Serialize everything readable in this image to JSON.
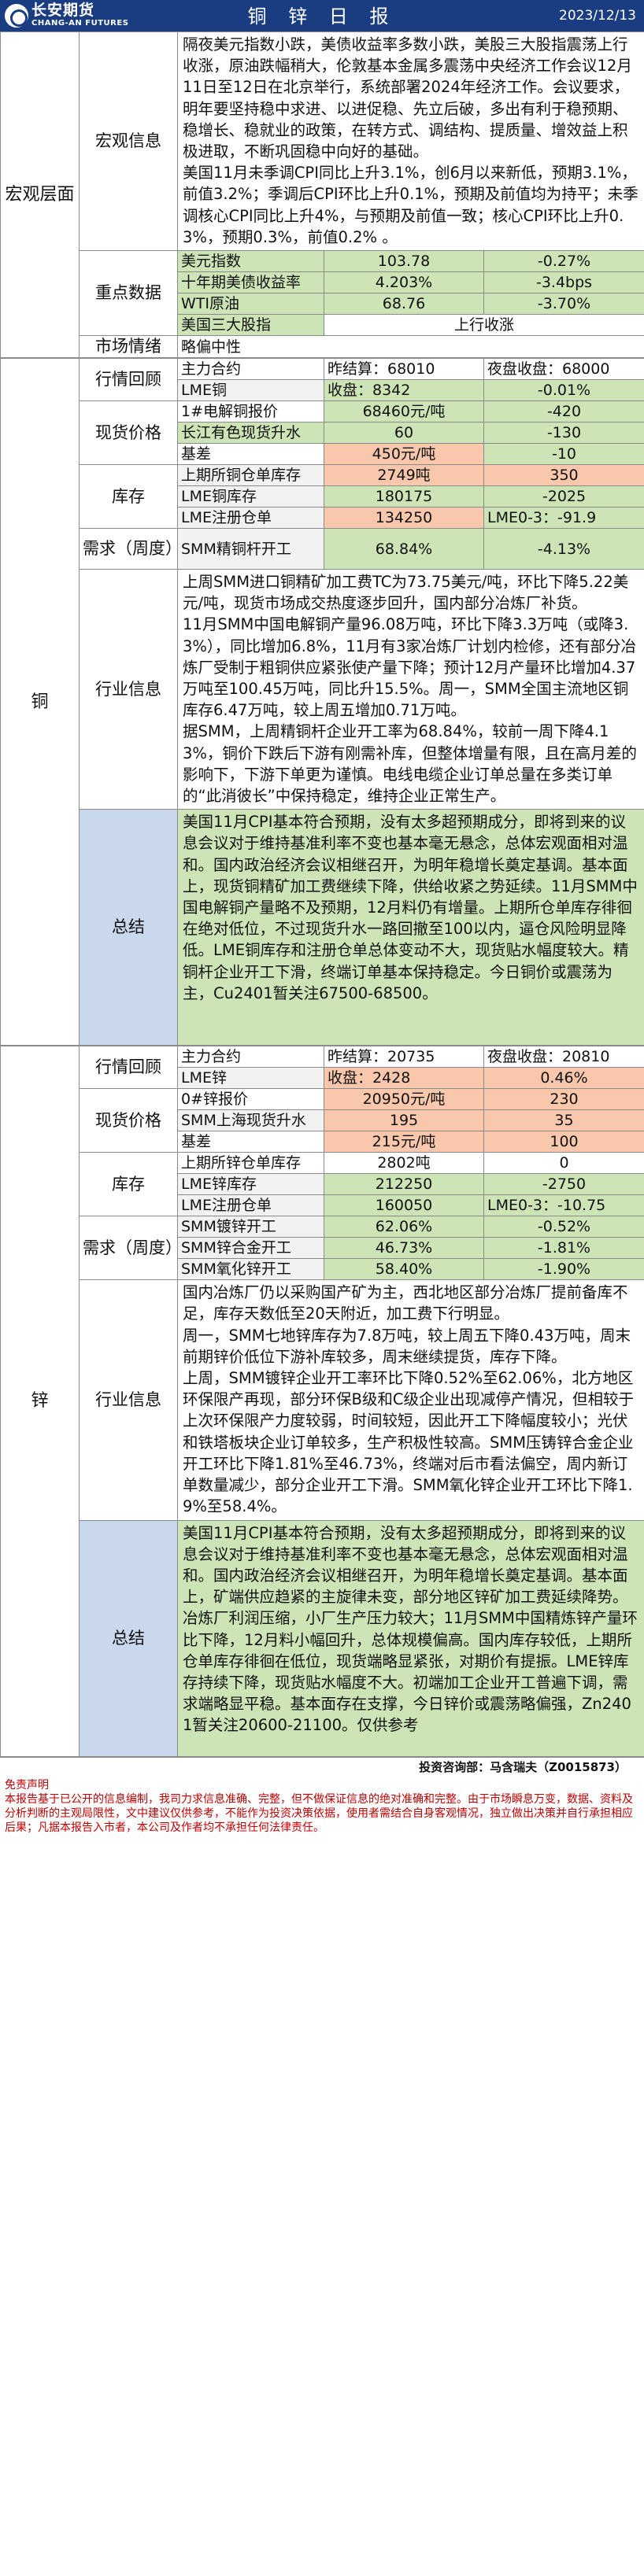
{
  "header": {
    "brand_cn": "长安期货",
    "brand_en": "CHANG-AN FUTURES",
    "title": "铜 锌 日 报",
    "date": "2023/12/13"
  },
  "macro": {
    "section": "宏观层面",
    "info_label": "宏观信息",
    "info_text": "隔夜美元指数小跌，美债收益率多数小跌，美股三大股指震荡上行收涨，原油跌幅稍大，伦敦基本金属多震荡中央经济工作会议12月11日至12日在北京举行，系统部署2024年经济工作。会议要求，明年要坚持稳中求进、以进促稳、先立后破，多出有利于稳预期、稳增长、稳就业的政策，在转方式、调结构、提质量、增效益上积极进取，不断巩固稳中向好的基础。\n美国11月未季调CPI同比上升3.1%，创6月以来新低，预期3.1%，前值3.2%；季调后CPI环比上升0.1%，预期及前值均为持平；未季调核心CPI同比上升4%，与预期及前值一致；核心CPI环比上升0.3%，预期0.3%，前值0.2% 。",
    "key_label": "重点数据",
    "key_rows": [
      {
        "name": "美元指数",
        "value": "103.78",
        "change": "-0.27%"
      },
      {
        "name": "十年期美债收益率",
        "value": "4.203%",
        "change": "-3.4bps"
      },
      {
        "name": "WTI原油",
        "value": "68.76",
        "change": "-3.70%"
      },
      {
        "name": "美国三大股指",
        "merged": "上行收涨"
      }
    ],
    "sentiment_label": "市场情绪",
    "sentiment_value": "略偏中性"
  },
  "copper": {
    "section": "铜",
    "review_label": "行情回顾",
    "review_head": {
      "name": "主力合约",
      "settle": "昨结算：68010",
      "night": "夜盘收盘：68000"
    },
    "review_row": {
      "name": "LME铜",
      "close": "收盘：8342",
      "change": "-0.01%"
    },
    "spot_label": "现货价格",
    "spot_rows": [
      {
        "name": "1#电解铜报价",
        "value": "68460元/吨",
        "change": "-420"
      },
      {
        "name": "长江有色现货升水",
        "value": "60",
        "change": "-130"
      },
      {
        "name": "基差",
        "value": "450元/吨",
        "change": "-10"
      }
    ],
    "stock_label": "库存",
    "stock_rows": [
      {
        "name": "上期所铜仓单库存",
        "value": "2749吨",
        "change": "350"
      },
      {
        "name": "LME铜库存",
        "value": "180175",
        "change": "-2025"
      },
      {
        "name": "LME注册仓单",
        "value": "134250",
        "change": "LME0-3：-91.9"
      }
    ],
    "demand_label": "需求（周度）",
    "demand_rows": [
      {
        "name": "SMM精铜杆开工",
        "value": "68.84%",
        "change": "-4.13%"
      }
    ],
    "industry_label": "行业信息",
    "industry_text": "上周SMM进口铜精矿加工费TC为73.75美元/吨，环比下降5.22美元/吨，现货市场成交热度逐步回升，国内部分冶炼厂补货。\n11月SMM中国电解铜产量96.08万吨，环比下降3.3万吨（或降3.3%），同比增加6.8%，11月有3家冶炼厂计划内检修，还有部分冶炼厂受制于粗铜供应紧张使产量下降；预计12月产量环比增加4.37万吨至100.45万吨，同比升15.5%。周一，SMM全国主流地区铜库存6.47万吨，较上周五增加0.71万吨。\n据SMM，上周精铜杆企业开工率为68.84%，较前一周下降4.13%，铜价下跌后下游有刚需补库，但整体增量有限，且在高月差的影响下，下游下单更为谨慎。电线电缆企业订单总量在多类订单的“此消彼长”中保持稳定，维持企业正常生产。",
    "summary_label": "总结",
    "summary_text": "美国11月CPI基本符合预期，没有太多超预期成分，即将到来的议息会议对于维持基准利率不变也基本毫无悬念，总体宏观面相对温和。国内政治经济会议相继召开，为明年稳增长奠定基调。基本面上，现货铜精矿加工费继续下降，供给收紧之势延续。11月SMM中国电解铜产量略不及预期，12月料仍有增量。上期所仓单库存徘徊在绝对低位，不过现货升水一路回撤至100以内，逼仓风险明显降低。LME铜库存和注册仓单总体变动不大，现货贴水幅度较大。精铜杆企业开工下滑，终端订单基本保持稳定。今日铜价或震荡为主，Cu2401暂关注67500-68500。"
  },
  "zinc": {
    "section": "锌",
    "review_label": "行情回顾",
    "review_head": {
      "name": "主力合约",
      "settle": "昨结算：20735",
      "night": "夜盘收盘：20810"
    },
    "review_row": {
      "name": "LME锌",
      "close": "收盘：2428",
      "change": "0.46%"
    },
    "spot_label": "现货价格",
    "spot_rows": [
      {
        "name": "0#锌报价",
        "value": "20950元/吨",
        "change": "230"
      },
      {
        "name": "SMM上海现货升水",
        "value": "195",
        "change": "35"
      },
      {
        "name": "基差",
        "value": "215元/吨",
        "change": "100"
      }
    ],
    "stock_label": "库存",
    "stock_rows": [
      {
        "name": "上期所锌仓单库存",
        "value": "2802吨",
        "change": "0"
      },
      {
        "name": "LME锌库存",
        "value": "212250",
        "change": "-2750"
      },
      {
        "name": "LME注册仓单",
        "value": "160050",
        "change": "LME0-3：-10.75"
      }
    ],
    "demand_label": "需求（周度）",
    "demand_rows": [
      {
        "name": "SMM镀锌开工",
        "value": "62.06%",
        "change": "-0.52%"
      },
      {
        "name": "SMM锌合金开工",
        "value": "46.73%",
        "change": "-1.81%"
      },
      {
        "name": "SMM氧化锌开工",
        "value": "58.40%",
        "change": "-1.90%"
      }
    ],
    "industry_label": "行业信息",
    "industry_text": "国内冶炼厂仍以采购国产矿为主，西北地区部分冶炼厂提前备库不足，库存天数低至20天附近，加工费下行明显。\n周一，SMM七地锌库存为7.8万吨，较上周五下降0.43万吨，周末前期锌价低位下游补库较多，周末继续提货，库存下降。\n上周，SMM镀锌企业开工率环比下降0.52%至62.06%，北方地区环保限产再现，部分环保B级和C级企业出现减停产情况，但相较于上次环保限产力度较弱，时间较短，因此开工下降幅度较小；光伏和铁塔板块企业订单较多，生产积极性较高。SMM压铸锌合金企业开工环比下降1.81%至46.73%，终端对后市看法偏空，周内新订单数量减少，部分企业开工下滑。SMM氧化锌企业开工环比下降1.9%至58.4%。",
    "summary_label": "总结",
    "summary_text": "美国11月CPI基本符合预期，没有太多超预期成分，即将到来的议息会议对于维持基准利率不变也基本毫无悬念，总体宏观面相对温和。国内政治经济会议相继召开，为明年稳增长奠定基调。基本面上，矿端供应趋紧的主旋律未变，部分地区锌矿加工费延续降势。冶炼厂利润压缩，小厂生产压力较大；11月SMM中国精炼锌产量环比下降，12月料小幅回升，总体规模偏高。国内库存较低，上期所仓单库存徘徊在低位，现货端略显紧张，对期价有提振。LME锌库存持续下降，现货贴水幅度不大。初端加工企业开工普遍下调，需求端略显平稳。基本面存在支撑，今日锌价或震荡略偏强，Zn2401暂关注20600-21100。仅供参考"
  },
  "footer": {
    "analyst": "投资咨询部：马含瑞夫（Z0015873）",
    "disclaimer_title": "免责声明",
    "disclaimer_text": "本报告基于已公开的信息编制，我司力求信息准确、完整，但不做保证信息的绝对准确和完整。由于市场瞬息万变，数据、资料及分析判断的主观局限性，文中建议仅供参考，不能作为投资决策依据，使用者需结合自身客观情况，独立做出决策并自行承担相应后果；凡据本报告入市者，本公司及作者均不承担任何法律责任。"
  }
}
